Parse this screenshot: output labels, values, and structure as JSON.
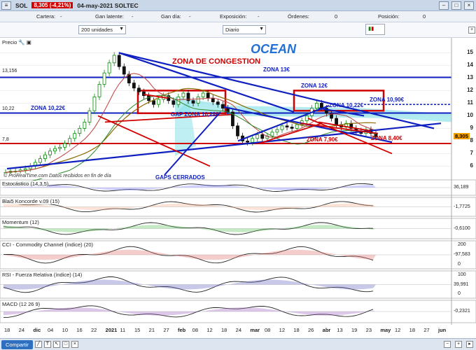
{
  "window": {
    "symbol_label": "SOL",
    "price": "8,305 (-4,21%)",
    "title": "04-may-2021 SOLTEC"
  },
  "info": {
    "cartera_label": "Cartera:",
    "cartera_value": "-",
    "latente_label": "Gan latente:",
    "latente_value": "-",
    "gandia_label": "Gan día:",
    "gandia_value": "-",
    "exposicion_label": "Exposición:",
    "exposicion_value": "-",
    "ordenes_label": "Órdenes:",
    "ordenes_value": "0",
    "posicion_label": "Posición:",
    "posicion_value": "0"
  },
  "toolbar": {
    "units": "200 unidades",
    "period": "Diario"
  },
  "chart": {
    "price_label": "Precio",
    "watermark": "OCEAN",
    "source_note": "© ProRealTime.com Datos recibidos en fin de día",
    "annotations": {
      "congestion": "ZONA DE CONGESTION",
      "z13": "ZONA 13€",
      "z12": "ZONA 12€",
      "z10_22_left": "ZONA 10,22€",
      "z10_90": "ZONA 10,90€",
      "z10_22_right": "ZONA 10,22€",
      "gap": "GAP ZONA 10,22€",
      "z7_90": "ZONA 7,90€",
      "z8_40": "ZONA 8,40€",
      "gaps": "GAPS CERRADOS"
    },
    "level_tags": {
      "l13": "13,156",
      "l10": "10,22",
      "l7": "7,8"
    },
    "price_ticks": [
      "15",
      "14",
      "13",
      "12",
      "11",
      "10",
      "9",
      "8",
      "7",
      "6"
    ],
    "last_price": "8,305"
  },
  "indicators": [
    {
      "name": "Estocástico (14,3,5)",
      "value": "36,189"
    },
    {
      "name": "Blai5 Koncorde v.09 (15)",
      "value": "-1,7725"
    },
    {
      "name": "Momentum (12)",
      "value": "-0,6100"
    },
    {
      "name": "CCI - Commodity Channel (índice) (20)",
      "value": "-97,583",
      "ticks": [
        "200",
        "0"
      ]
    },
    {
      "name": "RSI - Fuerza Relativa (índice) (14)",
      "value": "39,991",
      "ticks": [
        "100",
        "0"
      ]
    },
    {
      "name": "MACD (12 26 9)",
      "value": "-0,2321"
    }
  ],
  "x_axis": [
    "18",
    "24",
    "dic",
    "04",
    "10",
    "16",
    "22",
    "2021",
    "11",
    "15",
    "21",
    "27",
    "feb",
    "08",
    "12",
    "18",
    "24",
    "mar",
    "08",
    "12",
    "18",
    "26",
    "abr",
    "13",
    "19",
    "23",
    "may",
    "12",
    "18",
    "27",
    "jun"
  ],
  "bottom": {
    "share": "Compartir"
  },
  "colors": {
    "up": "#0a8a0a",
    "down": "#111111",
    "zone_red": "#d00000",
    "zone_blue": "#1020c0",
    "cloud": "#7fe0e8"
  }
}
